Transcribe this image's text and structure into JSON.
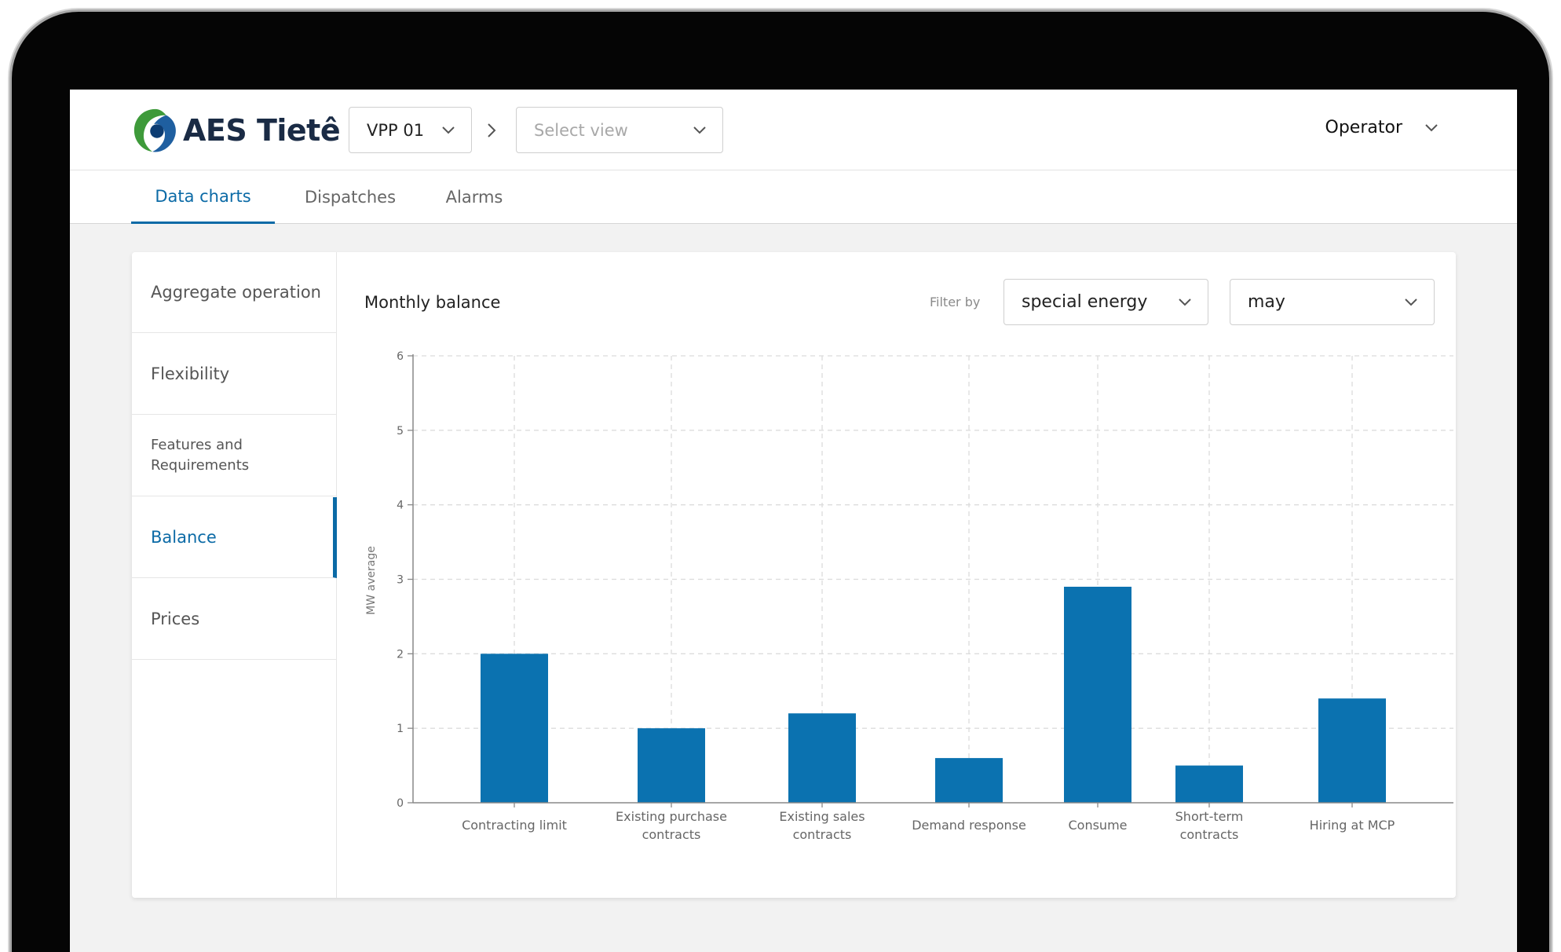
{
  "brand": {
    "name": "AES Tietê",
    "color": "#0b6aa6"
  },
  "header": {
    "vpp_select": "VPP 01",
    "view_select_placeholder": "Select view",
    "user_menu": "Operator"
  },
  "tabs": [
    {
      "label": "Data charts",
      "active": true
    },
    {
      "label": "Dispatches",
      "active": false
    },
    {
      "label": "Alarms",
      "active": false
    }
  ],
  "sidebar": {
    "items": [
      {
        "label": "Aggregate operation",
        "active": false
      },
      {
        "label": "Flexibility",
        "active": false
      },
      {
        "label": "Features and Requirements",
        "active": false
      },
      {
        "label": "Balance",
        "active": true
      },
      {
        "label": "Prices",
        "active": false
      }
    ]
  },
  "panel": {
    "title": "Monthly balance",
    "filter_label": "Filter by",
    "filter_energy": "special energy",
    "filter_month": "may"
  },
  "chart_data": {
    "type": "bar",
    "title": "Monthly balance",
    "xlabel": "",
    "ylabel": "MW average",
    "ylim": [
      0,
      6
    ],
    "yticks": [
      "0",
      "1",
      "2",
      "3",
      "4",
      "5",
      "6"
    ],
    "categories": [
      [
        "Contracting limit"
      ],
      [
        "Existing purchase",
        "contracts"
      ],
      [
        "Existing sales",
        "contracts"
      ],
      [
        "Demand response"
      ],
      [
        "Consume"
      ],
      [
        "Short-term",
        "contracts"
      ],
      [
        "Hiring at MCP"
      ]
    ],
    "values": [
      2.0,
      1.0,
      1.2,
      0.6,
      2.9,
      0.5,
      1.4
    ],
    "grid": true,
    "bar_color": "#0b72b0"
  }
}
